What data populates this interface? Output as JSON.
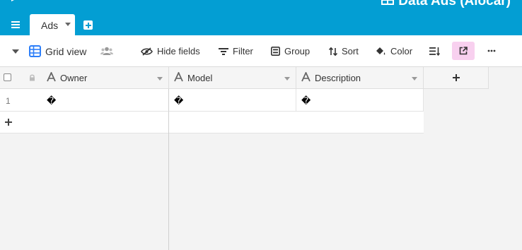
{
  "app": {
    "base_title": "Data Ads (Alocar)"
  },
  "tabs": [
    {
      "label": "Ads",
      "active": true
    }
  ],
  "toolbar": {
    "view_name": "Grid view",
    "hide_fields": "Hide fields",
    "filter": "Filter",
    "group": "Group",
    "sort": "Sort",
    "color": "Color"
  },
  "grid": {
    "fields": [
      {
        "name": "Owner",
        "type": "single-line-text"
      },
      {
        "name": "Model",
        "type": "single-line-text"
      },
      {
        "name": "Description",
        "type": "single-line-text"
      }
    ],
    "rows": [
      {
        "number": "1",
        "owner": "�",
        "model": "�",
        "description": "�"
      }
    ]
  },
  "colors": {
    "app_bar": "#039ed3",
    "share_button": "#f8d0ef",
    "grid_icon": "#2d7ff9"
  },
  "icons": {
    "view": "grid-icon",
    "collaborators": "people-icon",
    "hide_fields": "eye-slash-icon",
    "filter": "filter-icon",
    "group": "group-icon",
    "sort": "sort-icon",
    "color": "paint-bucket-icon",
    "row_height": "row-height-icon",
    "share": "share-icon",
    "more": "ellipsis-icon",
    "field_type": "text-field-icon"
  }
}
